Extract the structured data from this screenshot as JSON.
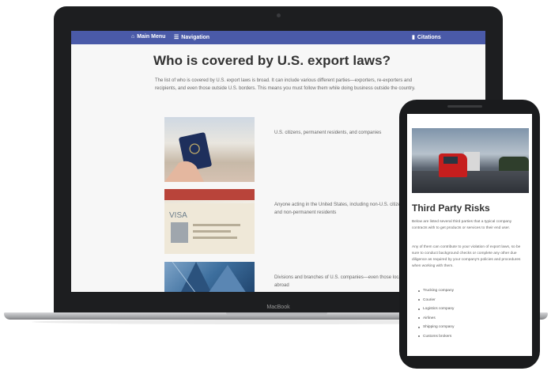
{
  "laptop": {
    "brand": "MacBook",
    "nav": {
      "main_menu": "Main Menu",
      "navigation": "Navigation",
      "citations": "Citations",
      "main_menu_icon": "home-icon",
      "navigation_icon": "menu-icon",
      "citations_icon": "book-icon"
    },
    "title": "Who is covered by U.S. export laws?",
    "intro": "The list of who is covered by U.S. export laws is broad. It can include various different parties—exporters, re-exporters and recipients, and even those outside U.S. borders. This means you must follow them while doing business outside the country.",
    "rows": [
      {
        "text": "U.S. citizens, permanent residents, and companies"
      },
      {
        "text": "Anyone acting in the United States, including non-U.S. citizens and non-permanent residents"
      },
      {
        "text": "Divisions and branches of U.S. companies—even those located abroad"
      }
    ]
  },
  "phone": {
    "title": "Third Party Risks",
    "p1": "Below are listed several third parties that a typical company contracts with to get products or services to their end user.",
    "p2": "Any of them can contribute to your violation of export laws, so be sure to conduct background checks or complete any other due diligence as required by your company's policies and procedures when working with them.",
    "list": [
      "Trucking company",
      "Courier",
      "Logistics company",
      "Airlines",
      "Shipping company",
      "Customs brokers"
    ]
  },
  "colors": {
    "nav_bar": "#4a5aa8",
    "device_frame": "#1d1e20",
    "truck_red": "#c61e1e"
  }
}
